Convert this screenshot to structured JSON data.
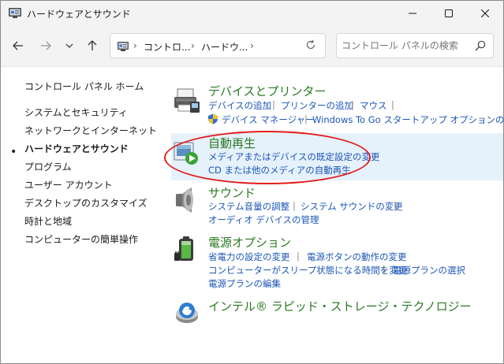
{
  "window": {
    "title": "ハードウェアとサウンド"
  },
  "address": {
    "crumbs": [
      "コントロ...",
      "ハードウ..."
    ]
  },
  "search": {
    "placeholder": "コントロール パネルの検索"
  },
  "leftnav": {
    "home": "コントロール パネル ホーム",
    "items": [
      "システムとセキュリティ",
      "ネットワークとインターネット",
      "ハードウェアとサウンド",
      "プログラム",
      "ユーザー アカウント",
      "デスクトップのカスタマイズ",
      "時計と地域",
      "コンピューターの簡単操作"
    ],
    "current_index": 2,
    "bullet": "•"
  },
  "categories": {
    "devices": {
      "title": "デバイスとプリンター",
      "links": [
        "デバイスの追加",
        "プリンターの追加",
        "マウス",
        "デバイス マネージャー",
        "Windows To Go スタートアップ オプションの変更"
      ]
    },
    "autoplay": {
      "title": "自動再生",
      "links": [
        "メディアまたはデバイスの既定設定の変更",
        "CD または他のメディアの自動再生"
      ]
    },
    "sound": {
      "title": "サウンド",
      "links": [
        "システム音量の調整",
        "システム サウンドの変更",
        "オーディオ デバイスの管理"
      ]
    },
    "power": {
      "title": "電源オプション",
      "links": [
        "省電力の設定の変更",
        "電源ボタンの動作の変更",
        "コンピューターがスリープ状態になる時間を変更",
        "電源プランの選択",
        "電源プランの編集"
      ]
    },
    "intel": {
      "title": "インテル® ラピッド・ストレージ・テクノロジー"
    }
  },
  "colors": {
    "category_title": "#2a7a22",
    "link": "#1c56b8",
    "highlight": "#e5f1fb",
    "annotation": "#e11b1b"
  }
}
